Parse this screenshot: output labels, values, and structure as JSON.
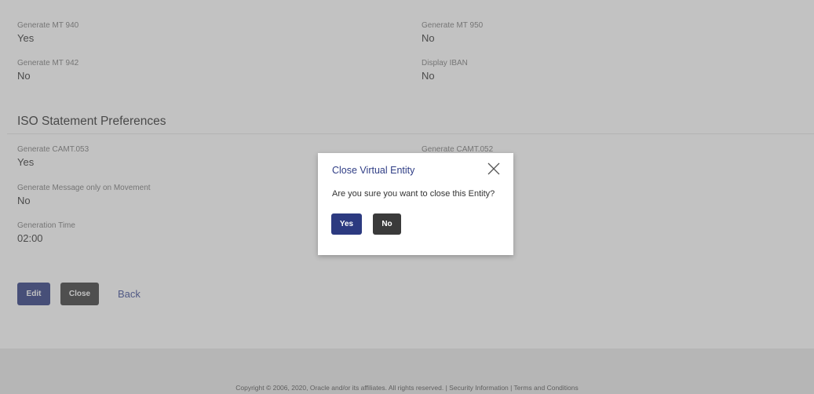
{
  "mt_preferences": {
    "fields": [
      {
        "label": "Generate MT 940",
        "value": "Yes"
      },
      {
        "label": "Generate MT 950",
        "value": "No"
      },
      {
        "label": "Generate MT 942",
        "value": "No"
      },
      {
        "label": "Display IBAN",
        "value": "No"
      }
    ]
  },
  "iso_preferences": {
    "title": "ISO Statement Preferences",
    "fields": [
      {
        "label": "Generate CAMT.053",
        "value": "Yes"
      },
      {
        "label": "Generate CAMT.052",
        "value": ""
      },
      {
        "label": "Generate Message only on Movement",
        "value": "No"
      },
      {
        "label": "Generation Time",
        "value": "02:00"
      }
    ]
  },
  "actions": {
    "edit_label": "Edit",
    "close_label": "Close",
    "back_label": "Back"
  },
  "footer": {
    "copyright": "Copyright © 2006, 2020, Oracle and/or its affiliates. All rights reserved. | Security Information | Terms and Conditions"
  },
  "modal": {
    "title": "Close Virtual Entity",
    "message": "Are you sure you want to close this Entity?",
    "yes_label": "Yes",
    "no_label": "No",
    "close_icon": "close-icon"
  },
  "colors": {
    "primary": "#2c3a80",
    "dark_button": "#3a3a3a",
    "link": "#3c4b94",
    "modal_title": "#2f3d85"
  }
}
